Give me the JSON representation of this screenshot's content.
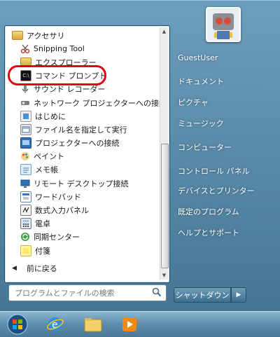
{
  "programs": [
    {
      "label": "アクセサリ",
      "icon": "folder-icon",
      "sub": false
    },
    {
      "label": "Snipping Tool",
      "icon": "scissors-icon",
      "sub": true
    },
    {
      "label": "エクスプローラー",
      "icon": "folder-icon",
      "sub": true
    },
    {
      "label": "コマンド プロンプト",
      "icon": "command-prompt-icon",
      "sub": true
    },
    {
      "label": "サウンド レコーダー",
      "icon": "microphone-icon",
      "sub": true
    },
    {
      "label": "ネットワーク プロジェクターへの接続",
      "icon": "projector-icon",
      "sub": true
    },
    {
      "label": "はじめに",
      "icon": "getting-started-icon",
      "sub": true
    },
    {
      "label": "ファイル名を指定して実行",
      "icon": "run-icon",
      "sub": true
    },
    {
      "label": "プロジェクターへの接続",
      "icon": "display-icon",
      "sub": true
    },
    {
      "label": "ペイント",
      "icon": "paint-icon",
      "sub": true
    },
    {
      "label": "メモ帳",
      "icon": "notepad-icon",
      "sub": true
    },
    {
      "label": "リモート デスクトップ接続",
      "icon": "remote-desktop-icon",
      "sub": true
    },
    {
      "label": "ワードパッド",
      "icon": "wordpad-icon",
      "sub": true
    },
    {
      "label": "数式入力パネル",
      "icon": "math-panel-icon",
      "sub": true
    },
    {
      "label": "電卓",
      "icon": "calculator-icon",
      "sub": true
    },
    {
      "label": "同期センター",
      "icon": "sync-icon",
      "sub": true
    },
    {
      "label": "付箋",
      "icon": "sticky-note-icon",
      "sub": true
    }
  ],
  "back_label": "前に戻る",
  "search_placeholder": "プログラムとファイルの検索",
  "right_panel": [
    {
      "label": "GuestUser"
    },
    {
      "label": "ドキュメント"
    },
    {
      "label": "ピクチャ"
    },
    {
      "label": "ミュージック"
    },
    {
      "label": "コンピューター"
    },
    {
      "label": "コントロール パネル"
    },
    {
      "label": "デバイスとプリンター"
    },
    {
      "label": "既定のプログラム"
    },
    {
      "label": "ヘルプとサポート"
    }
  ],
  "shutdown_label": "シャットダウン",
  "highlight_color": "#e60012"
}
